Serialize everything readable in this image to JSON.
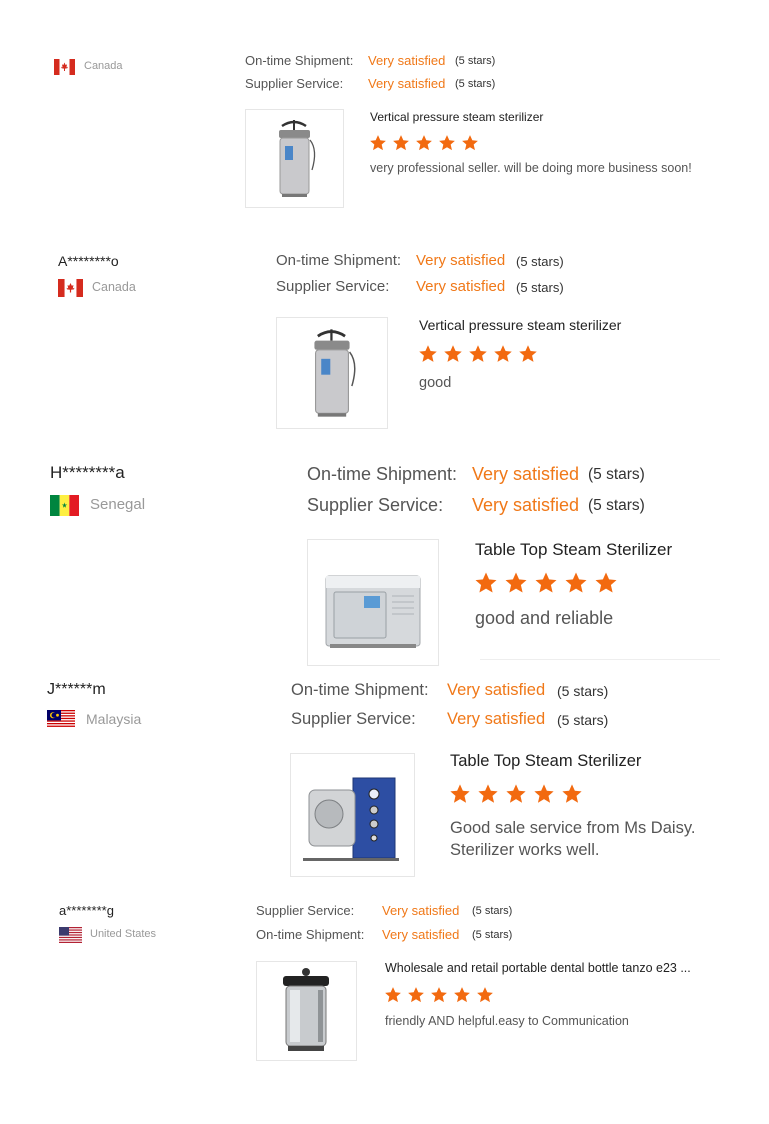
{
  "reviews": [
    {
      "name": "",
      "country": "Canada",
      "flag_icon": "canada-flag-icon",
      "ratings": [
        {
          "label": "On-time Shipment:",
          "value": "Very satisfied",
          "stars_text": "(5 stars)"
        },
        {
          "label": "Supplier Service:",
          "value": "Very satisfied",
          "stars_text": "(5 stars)"
        }
      ],
      "product": {
        "title": "Vertical pressure steam sterilizer",
        "image_icon": "vertical-sterilizer-image"
      },
      "rating": 5,
      "comment": "very professional seller. will be doing more business soon!"
    },
    {
      "name": "A********o",
      "country": "Canada",
      "flag_icon": "canada-flag-icon",
      "ratings": [
        {
          "label": "On-time Shipment:",
          "value": "Very satisfied",
          "stars_text": "(5 stars)"
        },
        {
          "label": "Supplier Service:",
          "value": "Very satisfied",
          "stars_text": "(5 stars)"
        }
      ],
      "product": {
        "title": "Vertical pressure steam sterilizer",
        "image_icon": "vertical-sterilizer-image"
      },
      "rating": 5,
      "comment": "good"
    },
    {
      "name": "H********a",
      "country": "Senegal",
      "flag_icon": "senegal-flag-icon",
      "ratings": [
        {
          "label": "On-time Shipment:",
          "value": "Very satisfied",
          "stars_text": "(5 stars)"
        },
        {
          "label": "Supplier Service:",
          "value": "Very satisfied",
          "stars_text": "(5 stars)"
        }
      ],
      "product": {
        "title": "Table Top Steam Sterilizer",
        "image_icon": "tabletop-sterilizer-image"
      },
      "rating": 5,
      "comment": "good and reliable"
    },
    {
      "name": "J******m",
      "country": "Malaysia",
      "flag_icon": "malaysia-flag-icon",
      "ratings": [
        {
          "label": "On-time Shipment:",
          "value": "Very satisfied",
          "stars_text": "(5 stars)"
        },
        {
          "label": "Supplier Service:",
          "value": "Very satisfied",
          "stars_text": "(5 stars)"
        }
      ],
      "product": {
        "title": "Table Top Steam Sterilizer",
        "image_icon": "tabletop-sterilizer-image"
      },
      "rating": 5,
      "comment": "Good sale service from Ms Daisy. Sterilizer works well."
    },
    {
      "name": "a********g",
      "country": "United States",
      "flag_icon": "us-flag-icon",
      "ratings": [
        {
          "label": "Supplier Service:",
          "value": "Very satisfied",
          "stars_text": "(5 stars)"
        },
        {
          "label": "On-time Shipment:",
          "value": "Very satisfied",
          "stars_text": "(5 stars)"
        }
      ],
      "product": {
        "title": "Wholesale and retail portable dental bottle tanzo e23 ...",
        "image_icon": "portable-autoclave-image"
      },
      "rating": 5,
      "comment": "friendly AND helpful.easy to Communication"
    }
  ],
  "colors": {
    "accent": "#f07818",
    "star": "#f26a10",
    "muted": "#999999"
  }
}
